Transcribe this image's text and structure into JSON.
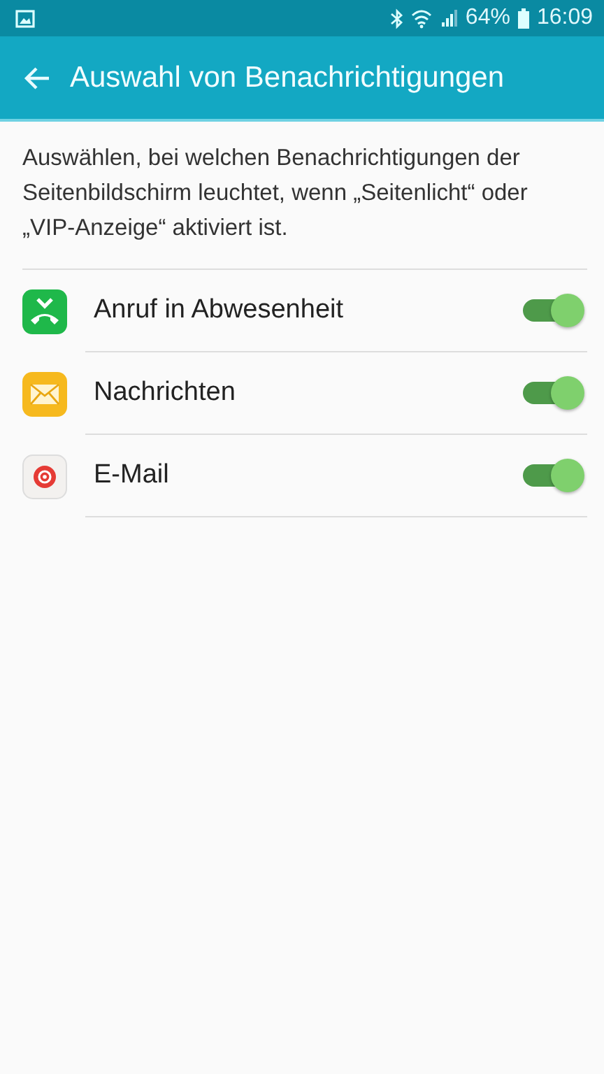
{
  "status_bar": {
    "battery": "64%",
    "time": "16:09"
  },
  "app_bar": {
    "title": "Auswahl von Benachrichtigungen"
  },
  "description": "Auswählen, bei welchen Benachrichtigungen der Seitenbildschirm leuchtet, wenn „Seitenlicht“ oder „VIP-Anzeige“ aktiviert ist.",
  "apps": [
    {
      "kind": "call",
      "label": "Anruf in Abwesenheit",
      "on": true
    },
    {
      "kind": "messages",
      "label": "Nachrichten",
      "on": true
    },
    {
      "kind": "email",
      "label": "E-Mail",
      "on": true
    }
  ]
}
